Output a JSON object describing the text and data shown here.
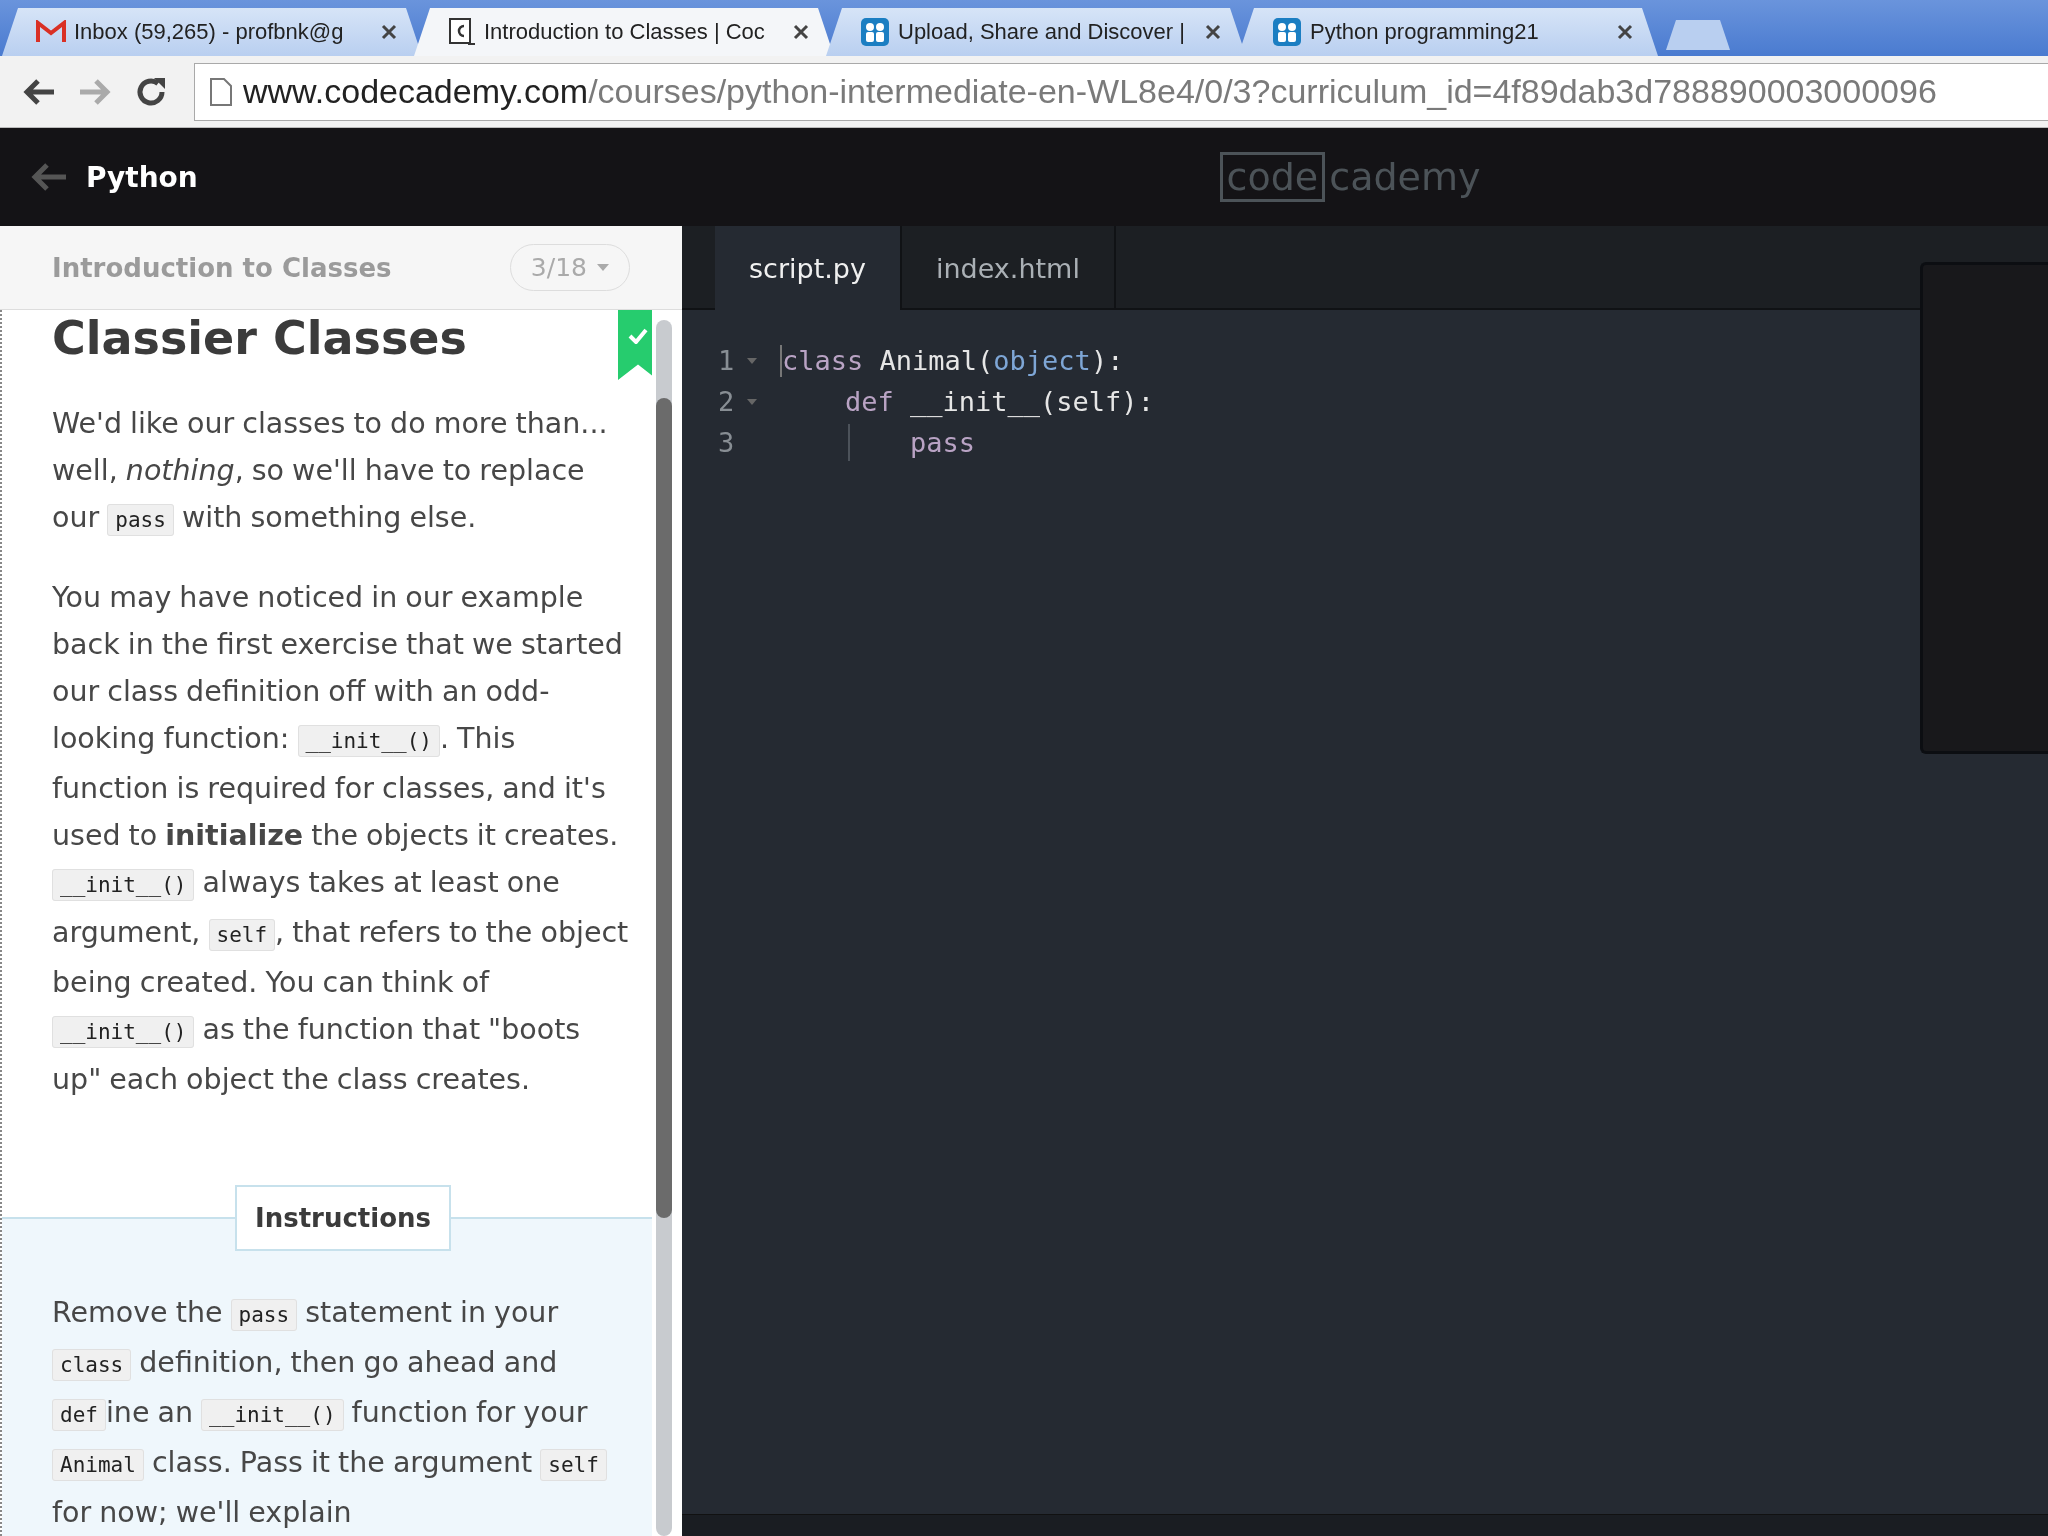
{
  "browser": {
    "tabs": [
      {
        "title": "Inbox (59,265) - profbnk@g",
        "selected": false
      },
      {
        "title": "Introduction to Classes | Coc",
        "selected": true
      },
      {
        "title": "Upload, Share and Discover |",
        "selected": false
      },
      {
        "title": "Python programming21",
        "selected": false
      }
    ],
    "url": {
      "host": "www.codecademy.com",
      "path": "/courses/python-intermediate-en-WL8e4/0/3?curriculum_id=4f89dab3d788890003000096"
    }
  },
  "header": {
    "back_label": "Python",
    "logo_boxed": "code",
    "logo_rest": "cademy"
  },
  "lesson": {
    "unit": "Introduction to Classes",
    "progress": "3/18",
    "title": "Classier Classes",
    "completed": true,
    "paragraphs": [
      [
        {
          "kind": "text",
          "text": "We'd like our classes to do more than... well, *nothing*, so we'll have to replace our "
        },
        {
          "kind": "code",
          "text": "pass"
        },
        {
          "kind": "text",
          "text": " with something else."
        }
      ],
      [
        {
          "kind": "text",
          "text": "You may have noticed in our example back in the first exercise that we started our class definition off with an odd-looking function: "
        },
        {
          "kind": "code",
          "text": "__init__()"
        },
        {
          "kind": "text",
          "text": ". This function is required for classes, and it's used to **initialize** the objects it creates. "
        },
        {
          "kind": "code",
          "text": "__init__()"
        },
        {
          "kind": "text",
          "text": " always takes at least one argument, "
        },
        {
          "kind": "code",
          "text": "self"
        },
        {
          "kind": "text",
          "text": ", that refers to the object being created. You can think of "
        },
        {
          "kind": "code",
          "text": "__init__()"
        },
        {
          "kind": "text",
          "text": " as the function that \"boots up\" each object the class creates."
        }
      ]
    ],
    "instructions_label": "Instructions",
    "instructions": [
      [
        {
          "kind": "text",
          "text": "Remove the "
        },
        {
          "kind": "code",
          "text": "pass"
        },
        {
          "kind": "text",
          "text": " statement in your "
        },
        {
          "kind": "code",
          "text": "class"
        },
        {
          "kind": "text",
          "text": " definition, then go ahead and "
        },
        {
          "kind": "code",
          "text": "def"
        },
        {
          "kind": "text",
          "text": "ine an "
        },
        {
          "kind": "code",
          "text": "__init__()"
        },
        {
          "kind": "text",
          "text": " function for your "
        },
        {
          "kind": "code",
          "text": "Animal"
        },
        {
          "kind": "text",
          "text": " class. Pass it the argument "
        },
        {
          "kind": "code",
          "text": "self"
        },
        {
          "kind": "text",
          "text": " for now; we'll explain"
        }
      ]
    ]
  },
  "editor": {
    "tabs": [
      {
        "label": "script.py",
        "selected": true
      },
      {
        "label": "index.html",
        "selected": false
      }
    ],
    "lines": [
      {
        "number": "1",
        "foldable": true,
        "indent_guide": false,
        "cursor": true,
        "tokens": [
          {
            "kind": "keyword",
            "text": "class"
          },
          {
            "kind": "name",
            "text": " Animal("
          },
          {
            "kind": "builtin",
            "text": "object"
          },
          {
            "kind": "name",
            "text": "):"
          }
        ]
      },
      {
        "number": "2",
        "foldable": true,
        "indent_guide": false,
        "cursor": false,
        "tokens": [
          {
            "kind": "keyword",
            "text": "    def"
          },
          {
            "kind": "name",
            "text": " __init__(self):"
          }
        ]
      },
      {
        "number": "3",
        "foldable": false,
        "indent_guide": true,
        "cursor": false,
        "tokens": [
          {
            "kind": "keyword",
            "text": "        pass"
          }
        ]
      }
    ]
  }
}
